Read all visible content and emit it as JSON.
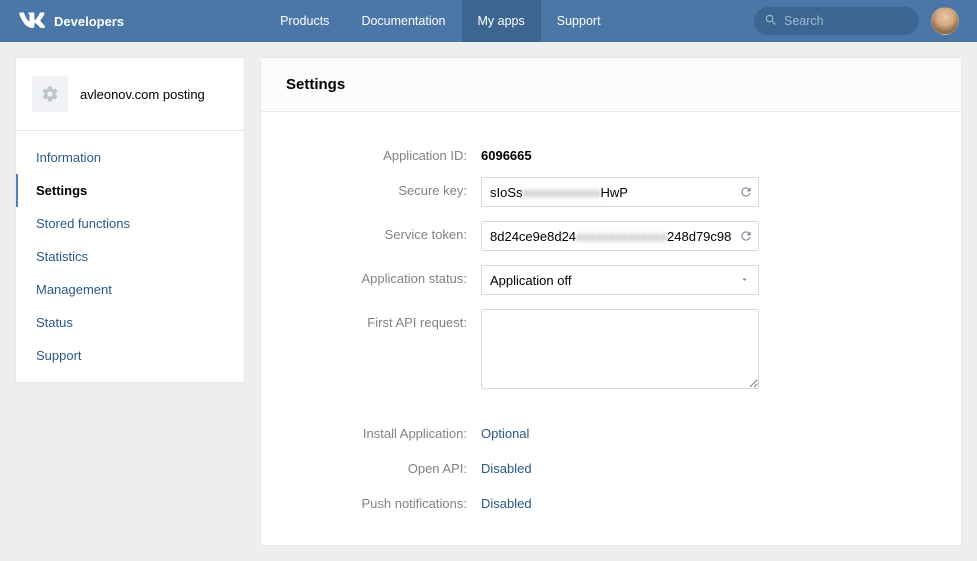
{
  "brand": "Developers",
  "nav": {
    "products": "Products",
    "documentation": "Documentation",
    "myapps": "My apps",
    "support": "Support"
  },
  "search": {
    "placeholder": "Search"
  },
  "sidebar": {
    "appName": "avleonov.com posting",
    "items": {
      "information": "Information",
      "settings": "Settings",
      "storedFunctions": "Stored functions",
      "statistics": "Statistics",
      "management": "Management",
      "status": "Status",
      "support": "Support"
    }
  },
  "main": {
    "title": "Settings",
    "labels": {
      "appId": "Application ID:",
      "secureKey": "Secure key:",
      "serviceToken": "Service token:",
      "appStatus": "Application status:",
      "firstApi": "First API request:",
      "installApp": "Install Application:",
      "openApi": "Open API:",
      "pushNotif": "Push notifications:"
    },
    "values": {
      "appId": "6096665",
      "secureKeyPrefix": "sIoSs",
      "secureKeySuffix": "HwP",
      "serviceTokenPrefix": "8d24ce9e8d24",
      "serviceTokenSuffix": "248d79c98",
      "appStatus": "Application off",
      "firstApi": "",
      "installApp": "Optional",
      "openApi": "Disabled",
      "pushNotif": "Disabled"
    }
  }
}
